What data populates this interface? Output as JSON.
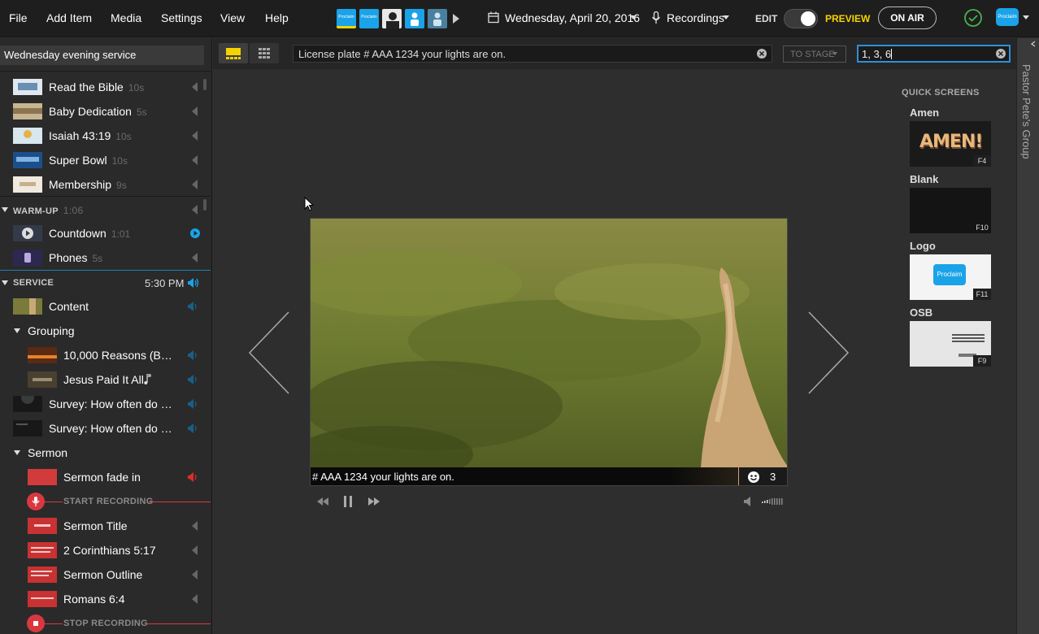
{
  "menu": {
    "file": "File",
    "add_item": "Add Item",
    "media": "Media",
    "settings": "Settings",
    "view": "View",
    "help": "Help"
  },
  "header": {
    "date": "Wednesday, April 20, 2016",
    "recordings": "Recordings",
    "edit": "EDIT",
    "preview": "PREVIEW",
    "on_air": "ON AIR",
    "logo_text": "Proclaim"
  },
  "toolbar_thumbs": [
    "Proclaim",
    "Proclaim"
  ],
  "service_title": "Wednesday evening service",
  "sidebar": {
    "pre_items": [
      {
        "title": "Read the Bible",
        "dur": "10s"
      },
      {
        "title": "Baby Dedication",
        "dur": "5s"
      },
      {
        "title": "Isaiah 43:19",
        "dur": "10s"
      },
      {
        "title": "Super Bowl",
        "dur": "10s"
      },
      {
        "title": "Membership",
        "dur": "9s"
      }
    ],
    "warmup": {
      "label": "WARM-UP",
      "dur": "1:06"
    },
    "warmup_items": [
      {
        "title": "Countdown",
        "dur": "1:01"
      },
      {
        "title": "Phones",
        "dur": "5s"
      }
    ],
    "service": {
      "label": "SERVICE",
      "time": "5:30 PM"
    },
    "content": "Content",
    "grouping": "Grouping",
    "group_items": [
      {
        "title": "10,000 Reasons (Ble…"
      },
      {
        "title": "Jesus Paid It All"
      }
    ],
    "survey_items": [
      {
        "title": "Survey: How often do y…"
      },
      {
        "title": "Survey: How often do y…"
      }
    ],
    "sermon": "Sermon",
    "sermon_fade": "Sermon fade in",
    "start_recording": "START RECORDING",
    "sermon_items": [
      {
        "title": "Sermon Title"
      },
      {
        "title": "2 Corinthians 5:17"
      },
      {
        "title": "Sermon Outline"
      },
      {
        "title": "Romans 6:4"
      }
    ],
    "stop_recording": "STOP RECORDING"
  },
  "toolbar": {
    "message": "License plate # AAA 1234 your lights are on.",
    "to_stage": "TO STAGE",
    "numbers": "1, 3, 6"
  },
  "preview": {
    "caption": "# AAA 1234 your lights are on.",
    "count": "3"
  },
  "quick_screens": {
    "heading": "QUICK SCREENS",
    "items": [
      {
        "name": "Amen",
        "key": "F4",
        "art": "AMEN!"
      },
      {
        "name": "Blank",
        "key": "F10"
      },
      {
        "name": "Logo",
        "key": "F11",
        "art": "Proclaim"
      },
      {
        "name": "OSB",
        "key": "F9"
      }
    ]
  },
  "right_rail": "Pastor Pete's Group",
  "colors": {
    "accent": "#f5d300",
    "blue": "#1aa3e8",
    "red": "#d9383f",
    "green": "#4caf50"
  }
}
